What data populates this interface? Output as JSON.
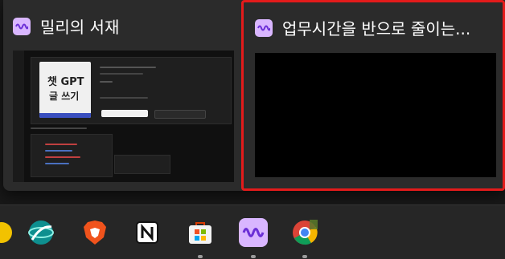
{
  "windows": [
    {
      "title": "밀리의 서재",
      "selected": false
    },
    {
      "title": "업무시간을 반으로 줄이는...",
      "selected": true
    }
  ],
  "preview1": {
    "book_line1": "챗 GPT",
    "book_line2": "글 쓰기"
  },
  "taskbar": {
    "apps": [
      {
        "name": "partial-app",
        "icon": "yellow-circle-icon"
      },
      {
        "name": "globe-app",
        "icon": "teal-globe-icon"
      },
      {
        "name": "brave",
        "icon": "brave-lion-icon"
      },
      {
        "name": "notion",
        "icon": "notion-icon"
      },
      {
        "name": "microsoft-store",
        "icon": "store-bag-icon"
      },
      {
        "name": "millie",
        "icon": "wave-icon"
      },
      {
        "name": "chrome",
        "icon": "chrome-icon"
      }
    ]
  },
  "colors": {
    "selection_border": "#e31b1b",
    "millie_icon_bg": "#d9b6ff",
    "millie_wave": "#6b2fd6"
  }
}
